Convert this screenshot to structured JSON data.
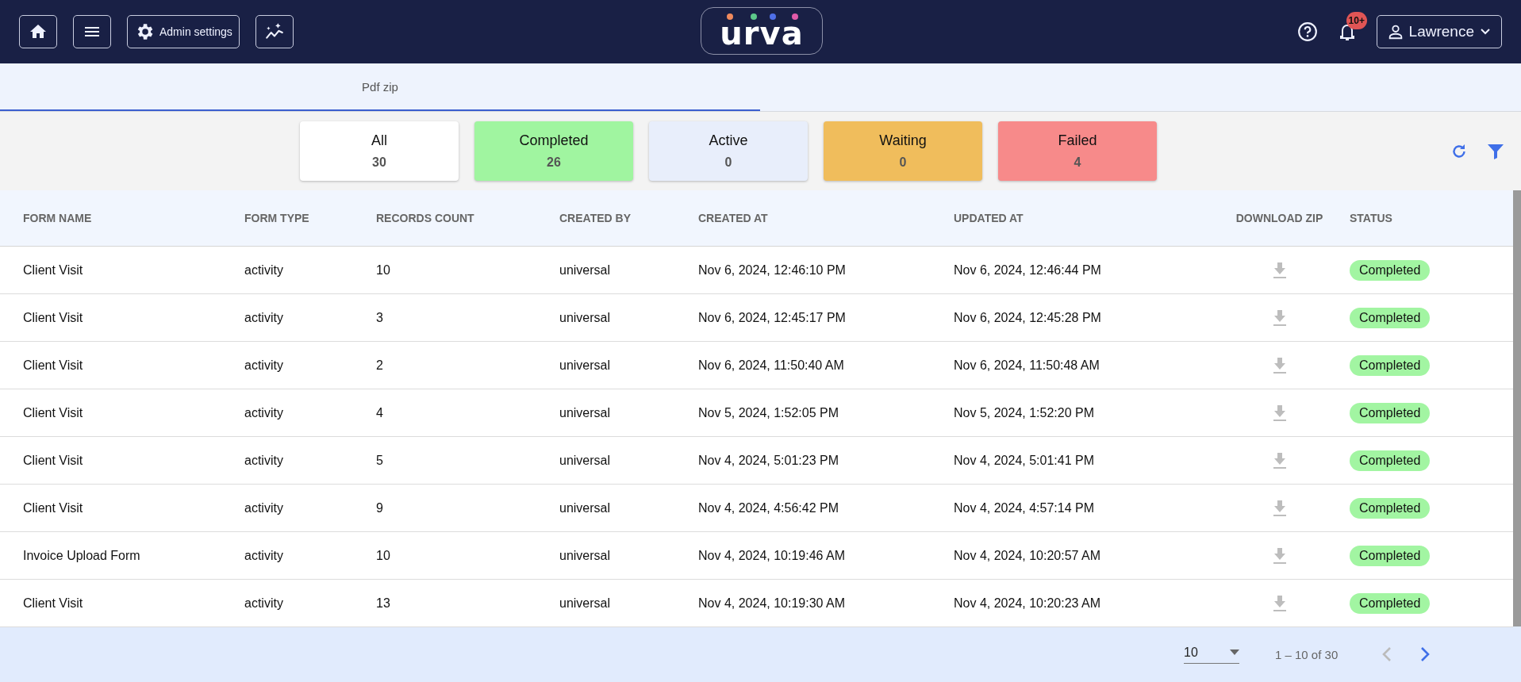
{
  "header": {
    "admin_button": "Admin settings",
    "logo": "urva",
    "notification_badge": "10+",
    "user": "Lawrence"
  },
  "tabs": [
    {
      "label": "Pdf zip",
      "selected": true
    }
  ],
  "filters": [
    {
      "label": "All",
      "count": "30",
      "color": "#ffffff"
    },
    {
      "label": "Completed",
      "count": "26",
      "color": "#a0f5a0"
    },
    {
      "label": "Active",
      "count": "0",
      "color": "#e8eefb"
    },
    {
      "label": "Waiting",
      "count": "0",
      "color": "#f0bd5c"
    },
    {
      "label": "Failed",
      "count": "4",
      "color": "#f78a8a"
    }
  ],
  "table": {
    "columns": [
      "FORM NAME",
      "FORM TYPE",
      "RECORDS COUNT",
      "CREATED BY",
      "CREATED AT",
      "UPDATED AT",
      "DOWNLOAD ZIP",
      "STATUS"
    ],
    "rows": [
      {
        "form_name": "Client Visit",
        "form_type": "activity",
        "records_count": "10",
        "created_by": "universal",
        "created_at": "Nov 6, 2024, 12:46:10 PM",
        "updated_at": "Nov 6, 2024, 12:46:44 PM",
        "status": "Completed"
      },
      {
        "form_name": "Client Visit",
        "form_type": "activity",
        "records_count": "3",
        "created_by": "universal",
        "created_at": "Nov 6, 2024, 12:45:17 PM",
        "updated_at": "Nov 6, 2024, 12:45:28 PM",
        "status": "Completed"
      },
      {
        "form_name": "Client Visit",
        "form_type": "activity",
        "records_count": "2",
        "created_by": "universal",
        "created_at": "Nov 6, 2024, 11:50:40 AM",
        "updated_at": "Nov 6, 2024, 11:50:48 AM",
        "status": "Completed"
      },
      {
        "form_name": "Client Visit",
        "form_type": "activity",
        "records_count": "4",
        "created_by": "universal",
        "created_at": "Nov 5, 2024, 1:52:05 PM",
        "updated_at": "Nov 5, 2024, 1:52:20 PM",
        "status": "Completed"
      },
      {
        "form_name": "Client Visit",
        "form_type": "activity",
        "records_count": "5",
        "created_by": "universal",
        "created_at": "Nov 4, 2024, 5:01:23 PM",
        "updated_at": "Nov 4, 2024, 5:01:41 PM",
        "status": "Completed"
      },
      {
        "form_name": "Client Visit",
        "form_type": "activity",
        "records_count": "9",
        "created_by": "universal",
        "created_at": "Nov 4, 2024, 4:56:42 PM",
        "updated_at": "Nov 4, 2024, 4:57:14 PM",
        "status": "Completed"
      },
      {
        "form_name": "Invoice Upload Form",
        "form_type": "activity",
        "records_count": "10",
        "created_by": "universal",
        "created_at": "Nov 4, 2024, 10:19:46 AM",
        "updated_at": "Nov 4, 2024, 10:20:57 AM",
        "status": "Completed"
      },
      {
        "form_name": "Client Visit",
        "form_type": "activity",
        "records_count": "13",
        "created_by": "universal",
        "created_at": "Nov 4, 2024, 10:19:30 AM",
        "updated_at": "Nov 4, 2024, 10:20:23 AM",
        "status": "Completed"
      }
    ]
  },
  "pagination": {
    "page_size": "10",
    "range": "1 – 10 of 30",
    "prev_disabled": true,
    "next_disabled": false
  }
}
